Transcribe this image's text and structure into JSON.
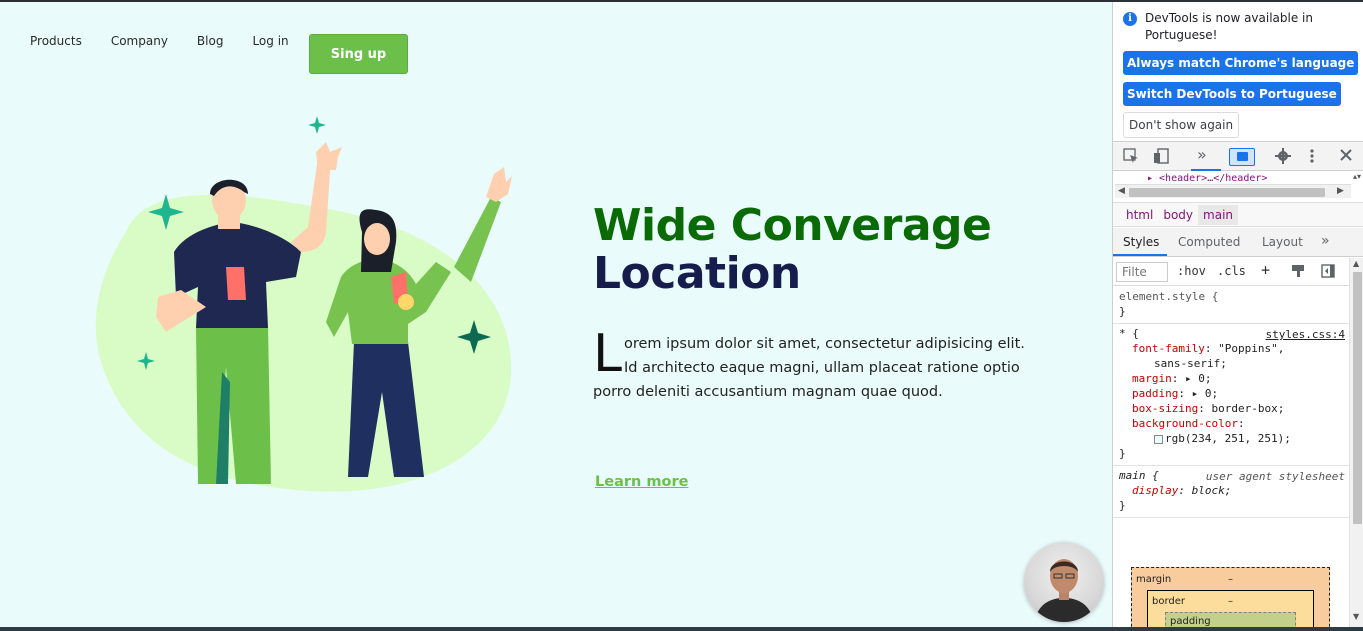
{
  "page": {
    "nav": {
      "items": [
        "Products",
        "Company",
        "Blog",
        "Log in"
      ],
      "signup_label": "Sing up"
    },
    "hero": {
      "title_line1": "Wide Converage",
      "title_line2": "Location",
      "drop_cap": "L",
      "paragraph": "orem ipsum dolor sit amet, consectetur adipisicing elit. Id architecto eaque magni, ullam placeat ratione optio porro deleniti accusantium magnam quae quod.",
      "learn_more": "Learn more"
    },
    "colors": {
      "page_bg": "#eafbfb",
      "accent_green": "#6cc04a",
      "title_green": "#0a6a06",
      "title_navy": "#161c4b"
    }
  },
  "devtools": {
    "notice": {
      "text": "DevTools is now available in Portuguese!",
      "btn_match": "Always match Chrome's language",
      "btn_switch": "Switch DevTools to Portuguese",
      "btn_dont": "Don't show again",
      "close": "×"
    },
    "toolbar": {
      "more_tabs": "»"
    },
    "dom_line": "▸ <header>…</header>",
    "breadcrumbs": [
      "html",
      "body",
      "main"
    ],
    "tabs": [
      "Styles",
      "Computed",
      "Layout",
      "»"
    ],
    "filter": {
      "placeholder": "Filte",
      "hov": ":hov",
      "cls": ".cls",
      "add": "+"
    },
    "rules": {
      "element_style": "element.style {",
      "close_brace": "}",
      "universal_selector": "* {",
      "universal_source": "styles.css:4",
      "font_family_prop": "font-family",
      "font_family_val": "\"Poppins\",",
      "font_family_val2": "sans-serif;",
      "margin_prop": "margin",
      "margin_val": "▸ 0;",
      "padding_prop": "padding",
      "padding_val": "▸ 0;",
      "box_sizing_prop": "box-sizing",
      "box_sizing_val": "border-box;",
      "bg_prop": "background-color",
      "bg_val": "rgb(234, 251, 251);",
      "main_selector": "main {",
      "main_source": "user agent stylesheet",
      "display_prop": "display",
      "display_val": "block;"
    },
    "box_model": {
      "margin_label": "margin",
      "margin_value": "–",
      "border_label": "border",
      "border_value": "–",
      "padding_label": "padding"
    }
  }
}
